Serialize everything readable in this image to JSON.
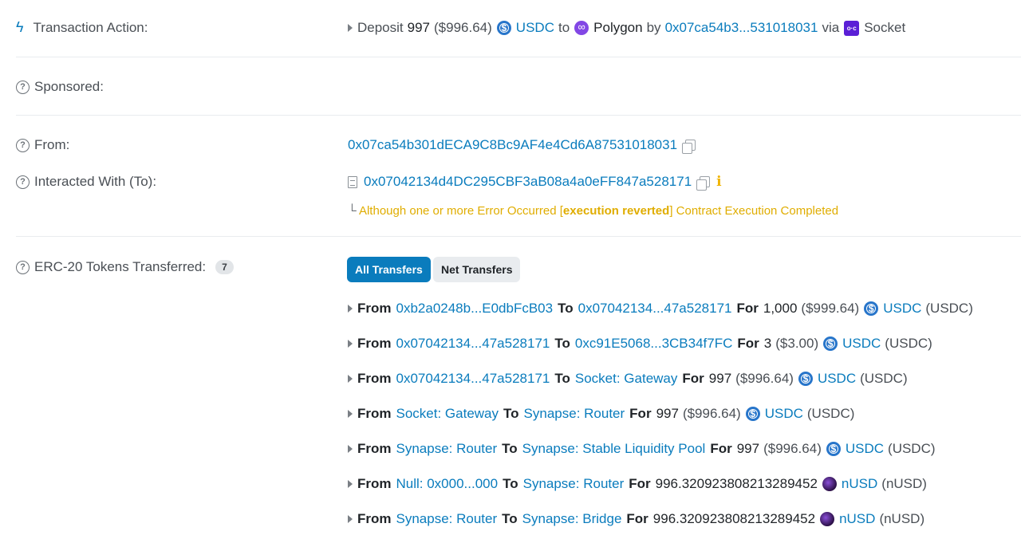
{
  "action": {
    "label": "Transaction Action:",
    "deposit": "Deposit",
    "amount": "997",
    "usd": "($996.64)",
    "token": "USDC",
    "to": "to",
    "chain": "Polygon",
    "by": "by",
    "address": "0x07ca54b3...531018031",
    "via": "via",
    "bridge": "Socket"
  },
  "sponsored": {
    "label": "Sponsored:"
  },
  "from": {
    "label": "From:",
    "address": "0x07ca54b301dECA9C8Bc9AF4e4Cd6A87531018031"
  },
  "interacted": {
    "label": "Interacted With (To):",
    "address": "0x07042134d4DC295CBF3aB08a4a0eFF847a528171",
    "warning_pre": "Although one or more Error Occurred [",
    "warning_bold": "execution reverted",
    "warning_post": "] Contract Execution Completed"
  },
  "tokens": {
    "label": "ERC-20 Tokens Transferred:",
    "count": "7",
    "tabs": [
      "All Transfers",
      "Net Transfers"
    ],
    "from_kw": "From",
    "to_kw": "To",
    "for_kw": "For",
    "transfers": [
      {
        "from": "0xb2a0248b...E0dbFcB03",
        "to": "0x07042134...47a528171",
        "amount": "1,000",
        "usd": "($999.64)",
        "token": "USDC",
        "symbol": "(USDC)",
        "icon": "usdc"
      },
      {
        "from": "0x07042134...47a528171",
        "to": "0xc91E5068...3CB34f7FC",
        "amount": "3",
        "usd": "($3.00)",
        "token": "USDC",
        "symbol": "(USDC)",
        "icon": "usdc"
      },
      {
        "from": "0x07042134...47a528171",
        "to": "Socket: Gateway",
        "amount": "997",
        "usd": "($996.64)",
        "token": "USDC",
        "symbol": "(USDC)",
        "icon": "usdc"
      },
      {
        "from": "Socket: Gateway",
        "to": "Synapse: Router",
        "amount": "997",
        "usd": "($996.64)",
        "token": "USDC",
        "symbol": "(USDC)",
        "icon": "usdc"
      },
      {
        "from": "Synapse: Router",
        "to": "Synapse: Stable Liquidity Pool",
        "amount": "997",
        "usd": "($996.64)",
        "token": "USDC",
        "symbol": "(USDC)",
        "icon": "usdc"
      },
      {
        "from": "Null: 0x000...000",
        "to": "Synapse: Router",
        "amount": "996.320923808213289452",
        "usd": "",
        "token": "nUSD",
        "symbol": "(nUSD)",
        "icon": "nusd"
      },
      {
        "from": "Synapse: Router",
        "to": "Synapse: Bridge",
        "amount": "996.320923808213289452",
        "usd": "",
        "token": "nUSD",
        "symbol": "(nUSD)",
        "icon": "nusd"
      }
    ]
  }
}
